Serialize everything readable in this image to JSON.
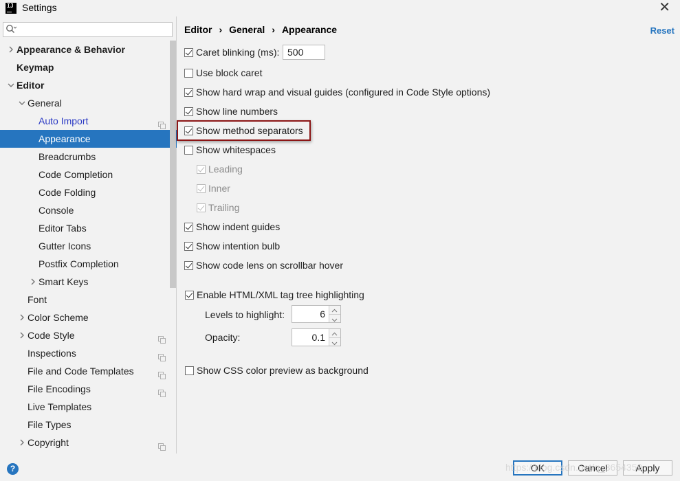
{
  "window": {
    "title": "Settings",
    "icon_text": "IJ"
  },
  "search": {
    "placeholder": ""
  },
  "tree": [
    {
      "label": "Appearance & Behavior",
      "level": 0,
      "arrow": "right",
      "bold": true
    },
    {
      "label": "Keymap",
      "level": 0,
      "arrow": "",
      "bold": true
    },
    {
      "label": "Editor",
      "level": 0,
      "arrow": "down",
      "bold": true
    },
    {
      "label": "General",
      "level": 1,
      "arrow": "down"
    },
    {
      "label": "Auto Import",
      "level": 2,
      "link": true,
      "copy": true
    },
    {
      "label": "Appearance",
      "level": 2,
      "selected": true
    },
    {
      "label": "Breadcrumbs",
      "level": 2
    },
    {
      "label": "Code Completion",
      "level": 2
    },
    {
      "label": "Code Folding",
      "level": 2
    },
    {
      "label": "Console",
      "level": 2
    },
    {
      "label": "Editor Tabs",
      "level": 2
    },
    {
      "label": "Gutter Icons",
      "level": 2
    },
    {
      "label": "Postfix Completion",
      "level": 2
    },
    {
      "label": "Smart Keys",
      "level": 2,
      "arrow": "right"
    },
    {
      "label": "Font",
      "level": 1
    },
    {
      "label": "Color Scheme",
      "level": 1,
      "arrow": "right"
    },
    {
      "label": "Code Style",
      "level": 1,
      "arrow": "right",
      "copy": true
    },
    {
      "label": "Inspections",
      "level": 1,
      "copy": true
    },
    {
      "label": "File and Code Templates",
      "level": 1,
      "copy": true
    },
    {
      "label": "File Encodings",
      "level": 1,
      "copy": true
    },
    {
      "label": "Live Templates",
      "level": 1
    },
    {
      "label": "File Types",
      "level": 1
    },
    {
      "label": "Copyright",
      "level": 1,
      "arrow": "right",
      "copy": true
    }
  ],
  "breadcrumb": [
    "Editor",
    "General",
    "Appearance"
  ],
  "reset_label": "Reset",
  "options": {
    "caret_blinking": {
      "label": "Caret blinking (ms):",
      "checked": true,
      "value": "500"
    },
    "block_caret": {
      "label": "Use block caret",
      "checked": false
    },
    "hard_wrap": {
      "label": "Show hard wrap and visual guides (configured in Code Style options)",
      "checked": true
    },
    "line_numbers": {
      "label": "Show line numbers",
      "checked": true
    },
    "method_separators": {
      "label": "Show method separators",
      "checked": true
    },
    "whitespaces": {
      "label": "Show whitespaces",
      "checked": false
    },
    "leading": {
      "label": "Leading",
      "checked": true,
      "disabled": true
    },
    "inner": {
      "label": "Inner",
      "checked": true,
      "disabled": true
    },
    "trailing": {
      "label": "Trailing",
      "checked": true,
      "disabled": true
    },
    "indent_guides": {
      "label": "Show indent guides",
      "checked": true
    },
    "intention_bulb": {
      "label": "Show intention bulb",
      "checked": true
    },
    "code_lens": {
      "label": "Show code lens on scrollbar hover",
      "checked": true
    },
    "tag_tree": {
      "label": "Enable HTML/XML tag tree highlighting",
      "checked": true
    },
    "css_preview": {
      "label": "Show CSS color preview as background",
      "checked": false
    }
  },
  "levels": {
    "label": "Levels to highlight:",
    "value": "6"
  },
  "opacity": {
    "label": "Opacity:",
    "value": "0.1"
  },
  "buttons": {
    "ok": "OK",
    "cancel": "Cancel",
    "apply": "Apply",
    "help": "?"
  },
  "watermark": "https://blog.csdn.net/q_3654359",
  "colors": {
    "accent": "#2675bf",
    "highlight_border": "#8b1515",
    "link": "#2a39c4"
  },
  "icons": {
    "search": "search-icon",
    "close": "close-icon",
    "help": "help-icon",
    "copy": "copy-icon"
  }
}
